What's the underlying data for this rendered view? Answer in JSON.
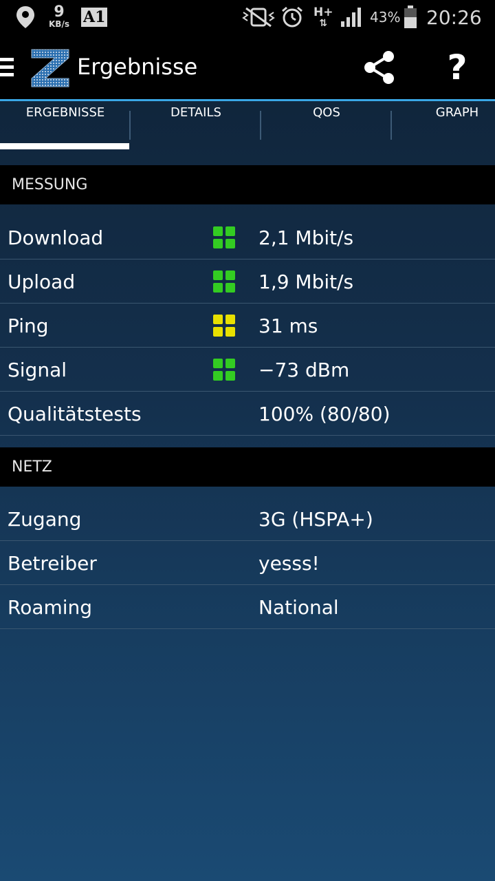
{
  "status_bar": {
    "speed_value": "9",
    "speed_unit": "KB/s",
    "carrier_badge": "A1",
    "network_type": "H+",
    "battery_percent": "43%",
    "time": "20:26",
    "icons": [
      "location-icon",
      "carrier-icon",
      "vibrate-mute-icon",
      "alarm-icon",
      "network-arrows-icon",
      "signal-icon",
      "battery-icon"
    ]
  },
  "app_bar": {
    "logo_letter": "Z",
    "title": "Ergebnisse",
    "share_icon": "share-icon",
    "help_label": "?"
  },
  "tabs": [
    {
      "label": "ERGEBNISSE",
      "active": true
    },
    {
      "label": "DETAILS",
      "active": false
    },
    {
      "label": "QOS",
      "active": false
    },
    {
      "label": "GRAPH",
      "active": false
    }
  ],
  "measurement": {
    "header": "MESSUNG",
    "rows": [
      {
        "label": "Download",
        "value": "2,1 Mbit/s",
        "quality_color": "#33cc22"
      },
      {
        "label": "Upload",
        "value": "1,9 Mbit/s",
        "quality_color": "#33cc22"
      },
      {
        "label": "Ping",
        "value": "31 ms",
        "quality_color": "#e8e000"
      },
      {
        "label": "Signal",
        "value": "−73 dBm",
        "quality_color": "#33cc22"
      },
      {
        "label": "Qualitätstests",
        "value": "100% (80/80)"
      }
    ]
  },
  "network": {
    "header": "NETZ",
    "rows": [
      {
        "label": "Zugang",
        "value": "3G (HSPA+)"
      },
      {
        "label": "Betreiber",
        "value": "yesss!"
      },
      {
        "label": "Roaming",
        "value": "National"
      }
    ]
  },
  "colors": {
    "accent_line": "#3aa7e6",
    "good": "#33cc22",
    "medium": "#e8e000"
  }
}
